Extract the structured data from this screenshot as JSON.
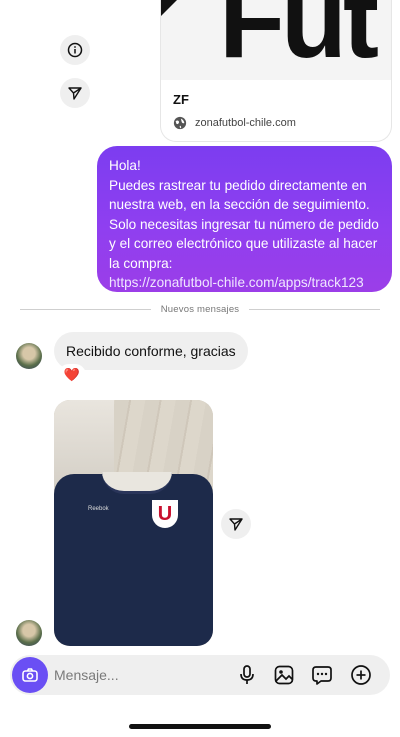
{
  "link_preview": {
    "image_text": "Fut",
    "title": "ZF",
    "domain": "zonafutbol-chile.com"
  },
  "side_actions": {
    "info_icon": "info-icon",
    "share_icon": "send-icon"
  },
  "outgoing_message": {
    "line1": "Hola!",
    "line2": "Puedes rastrear tu pedido directamente en nuestra web, en la sección de seguimiento.",
    "line3": "Solo necesitas ingresar tu número de pedido y el correo electrónico que utilizaste al hacer la compra:",
    "link": "https://zonafutbol-chile.com/apps/track123",
    "color_top": "#7c3df0",
    "color_bottom": "#9b3ee8"
  },
  "divider": {
    "label": "Nuevos mensajes"
  },
  "incoming_message": {
    "text": "Recibido conforme, gracias",
    "reaction": "❤️"
  },
  "photo_message": {
    "shirt_brand": "Reebok",
    "badge_letter": "U"
  },
  "composer": {
    "placeholder": "Mensaje...",
    "value": "",
    "accent": "#6a4ff4",
    "tools": [
      "mic-icon",
      "gallery-icon",
      "sticker-icon",
      "plus-circle-icon"
    ]
  }
}
